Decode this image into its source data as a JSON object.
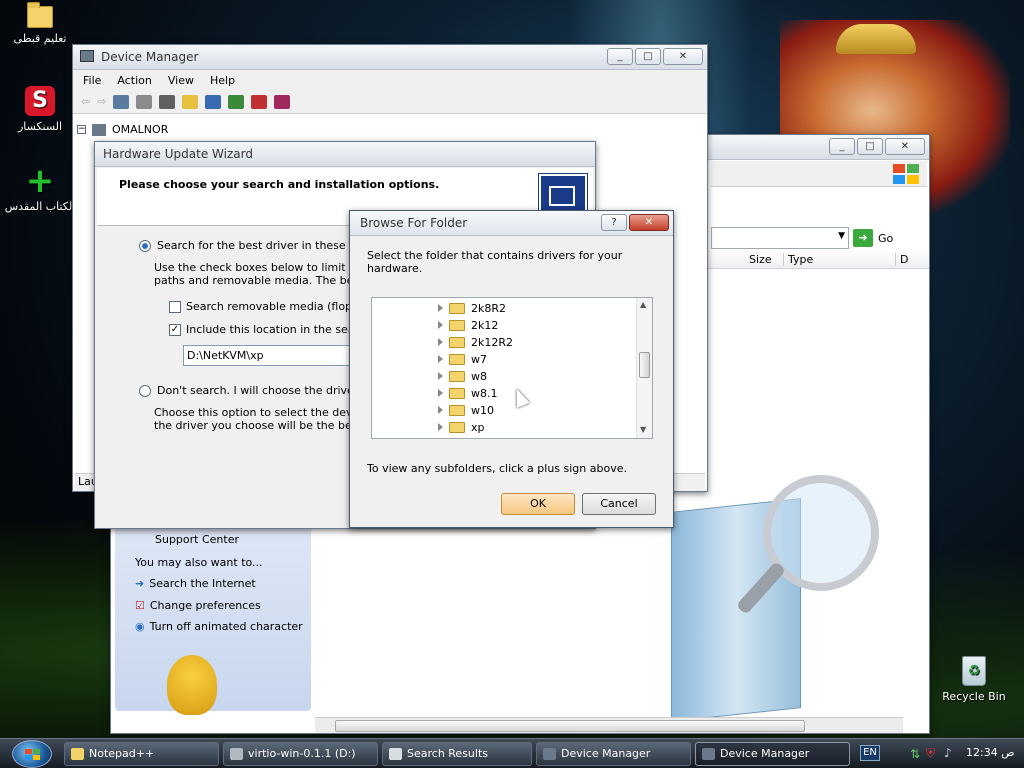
{
  "desktop": {
    "icons": [
      {
        "label": "تعليم قبطى",
        "icon": "folder-icon"
      },
      {
        "label": "السنكسار",
        "icon": "synaxarium-app-icon"
      },
      {
        "label": "الكتاب المقدس",
        "icon": "bible-app-icon"
      },
      {
        "label": "Recycle Bin",
        "icon": "recycle-bin-icon"
      }
    ]
  },
  "device_manager": {
    "title": "Device Manager",
    "menu": [
      "File",
      "Action",
      "View",
      "Help"
    ],
    "tree_root": "OMALNOR",
    "status_fragment": "Lau"
  },
  "wizard": {
    "title": "Hardware Update Wizard",
    "heading": "Please choose your search and installation options.",
    "option_search_label": "Search for the best driver in these locatio",
    "option_search_desc_1": "Use the check boxes below to limit or exp",
    "option_search_desc_2": "paths and removable media. The best driv",
    "check_removable_label": "Search removable media (floppy, C",
    "check_include_label": "Include this location in the search:",
    "path_value": "D:\\NetKVM\\xp",
    "option_dont_label": "Don't search. I will choose the driver to in",
    "option_dont_desc_1": "Choose this option to select the device dr",
    "option_dont_desc_2": "the driver you choose will be the best mat"
  },
  "search_window": {
    "address_go": "Go",
    "col_size": "Size",
    "col_type": "Type",
    "col_d": "D",
    "sidebar": {
      "support_center": "Support Center",
      "you_may_also": "You may also want to...",
      "links": [
        "Search the Internet",
        "Change preferences",
        "Turn off animated character"
      ]
    }
  },
  "browse_dialog": {
    "title": "Browse For Folder",
    "help_glyph": "?",
    "instruction": "Select the folder that contains drivers for your hardware.",
    "folders": [
      "2k8R2",
      "2k12",
      "2k12R2",
      "w7",
      "w8",
      "w8.1",
      "w10",
      "xp"
    ],
    "hint": "To view any subfolders, click a plus sign above.",
    "ok_label": "OK",
    "cancel_label": "Cancel"
  },
  "taskbar": {
    "tasks": [
      "Notepad++",
      "virtio-win-0.1.1 (D:)",
      "Search Results",
      "Device Manager",
      "Device Manager"
    ],
    "language": "EN",
    "clock": "12:34 ص"
  },
  "colors": {
    "accent": "#2a6fc0",
    "taskbar": "#1a2029",
    "default_button": "#f5c67e"
  }
}
